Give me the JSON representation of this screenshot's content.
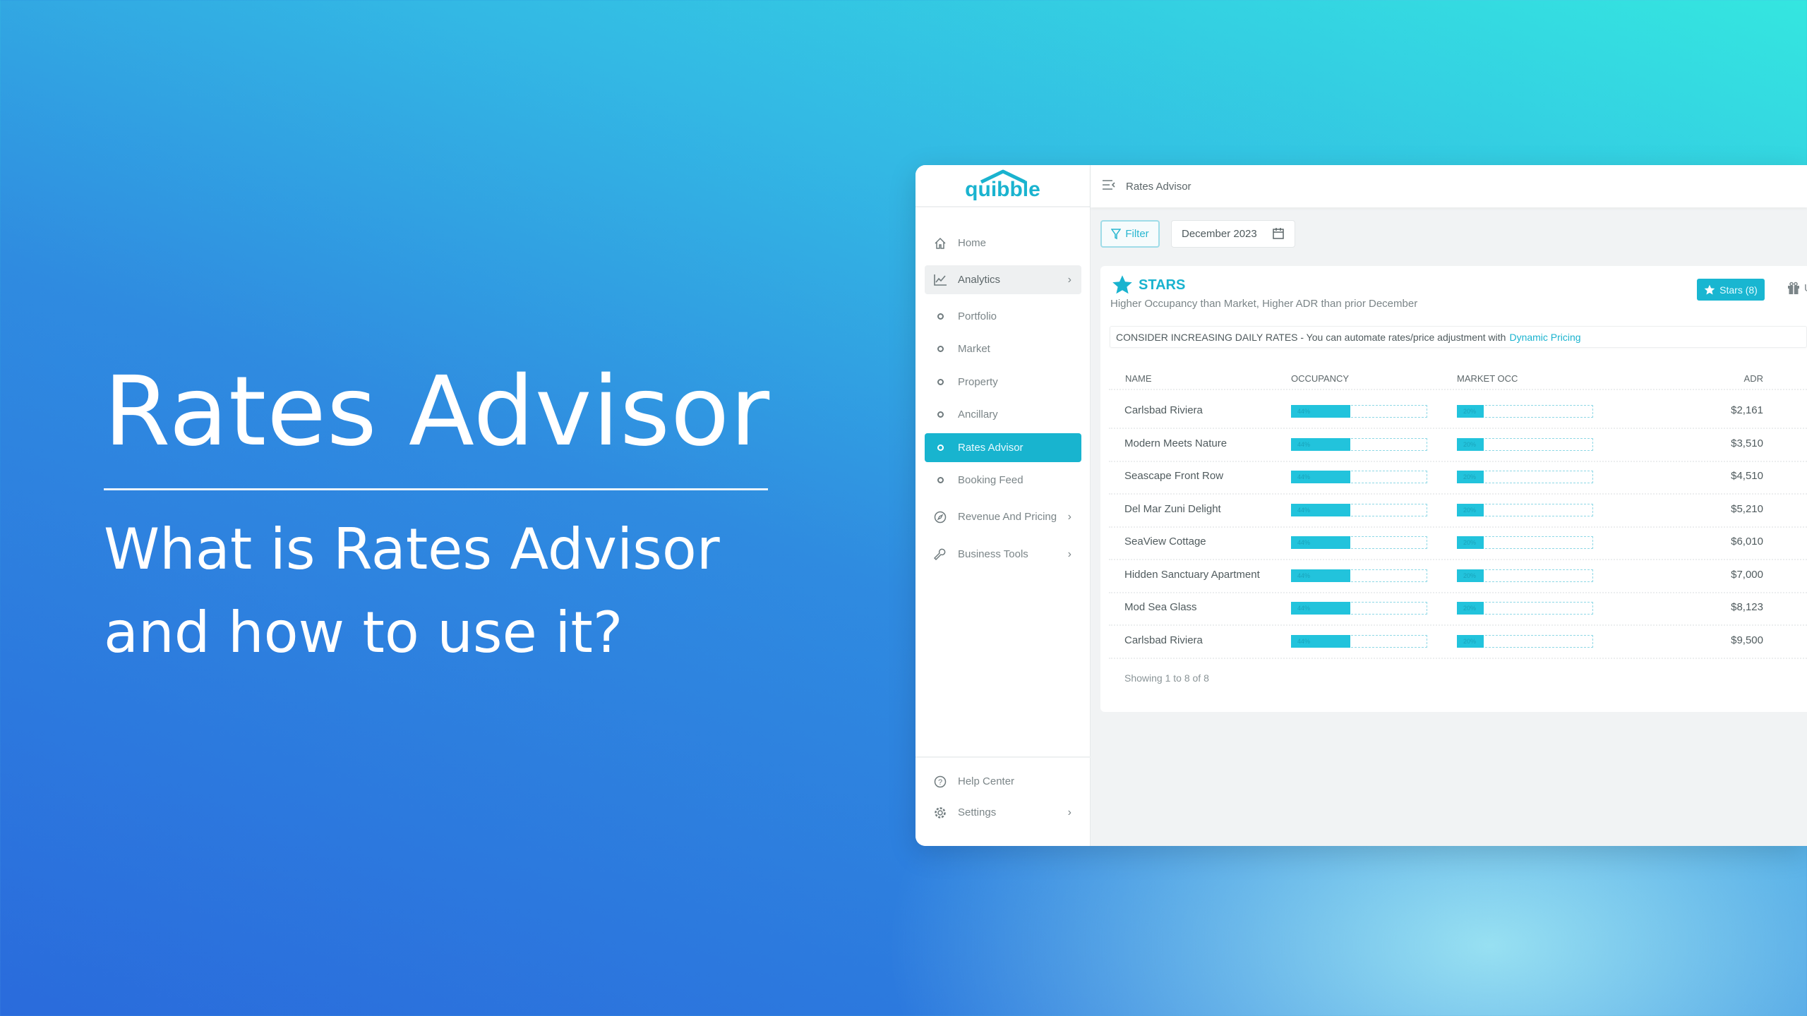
{
  "hero": {
    "title": "Rates Advisor",
    "subtitle_line1": "What is Rates Advisor",
    "subtitle_line2": "and how to use it?"
  },
  "app": {
    "logo": "quibble",
    "page_title": "Rates Advisor"
  },
  "sidebar": {
    "items": [
      {
        "label": "Home",
        "icon": "home-icon"
      },
      {
        "label": "Analytics",
        "icon": "chart-line-icon",
        "expanded": true
      },
      {
        "label": "Portfolio"
      },
      {
        "label": "Market"
      },
      {
        "label": "Property"
      },
      {
        "label": "Ancillary"
      },
      {
        "label": "Rates Advisor",
        "active": true
      },
      {
        "label": "Booking Feed"
      },
      {
        "label": "Revenue And Pricing",
        "icon": "compass-icon"
      },
      {
        "label": "Business Tools",
        "icon": "wrench-icon"
      }
    ],
    "bottom": [
      {
        "label": "Help Center",
        "icon": "help-icon"
      },
      {
        "label": "Settings",
        "icon": "gear-icon"
      }
    ]
  },
  "toolbar": {
    "filter_label": "Filter",
    "date_value": "December 2023"
  },
  "stars": {
    "title": "STARS",
    "subtitle": "Higher Occupancy than Market, Higher ADR than prior December",
    "button_label": "Stars (8)",
    "next_tab_partial": "U",
    "notice": "CONSIDER INCREASING DAILY RATES - You can automate rates/price adjustment with",
    "notice_link": "Dynamic Pricing"
  },
  "table": {
    "headers": [
      "NAME",
      "OCCUPANCY",
      "MARKET OCC",
      "ADR"
    ],
    "rows": [
      {
        "name": "Carlsbad Riviera",
        "occupancy": 44,
        "market_occ": 20,
        "adr": "$2,161"
      },
      {
        "name": "Modern Meets Nature",
        "occupancy": 44,
        "market_occ": 20,
        "adr": "$3,510"
      },
      {
        "name": "Seascape Front Row",
        "occupancy": 44,
        "market_occ": 20,
        "adr": "$4,510"
      },
      {
        "name": "Del Mar  Zuni Delight",
        "occupancy": 44,
        "market_occ": 20,
        "adr": "$5,210"
      },
      {
        "name": "SeaView Cottage",
        "occupancy": 44,
        "market_occ": 20,
        "adr": "$6,010"
      },
      {
        "name": "Hidden Sanctuary Apartment",
        "occupancy": 44,
        "market_occ": 20,
        "adr": "$7,000"
      },
      {
        "name": "Mod Sea Glass",
        "occupancy": 44,
        "market_occ": 20,
        "adr": "$8,123"
      },
      {
        "name": "Carlsbad Riviera",
        "occupancy": 44,
        "market_occ": 20,
        "adr": "$9,500"
      }
    ],
    "footer": "Showing 1 to 8 of 8"
  },
  "colors": {
    "accent": "#18b4cf",
    "bar_fill": "#22c3dc"
  }
}
